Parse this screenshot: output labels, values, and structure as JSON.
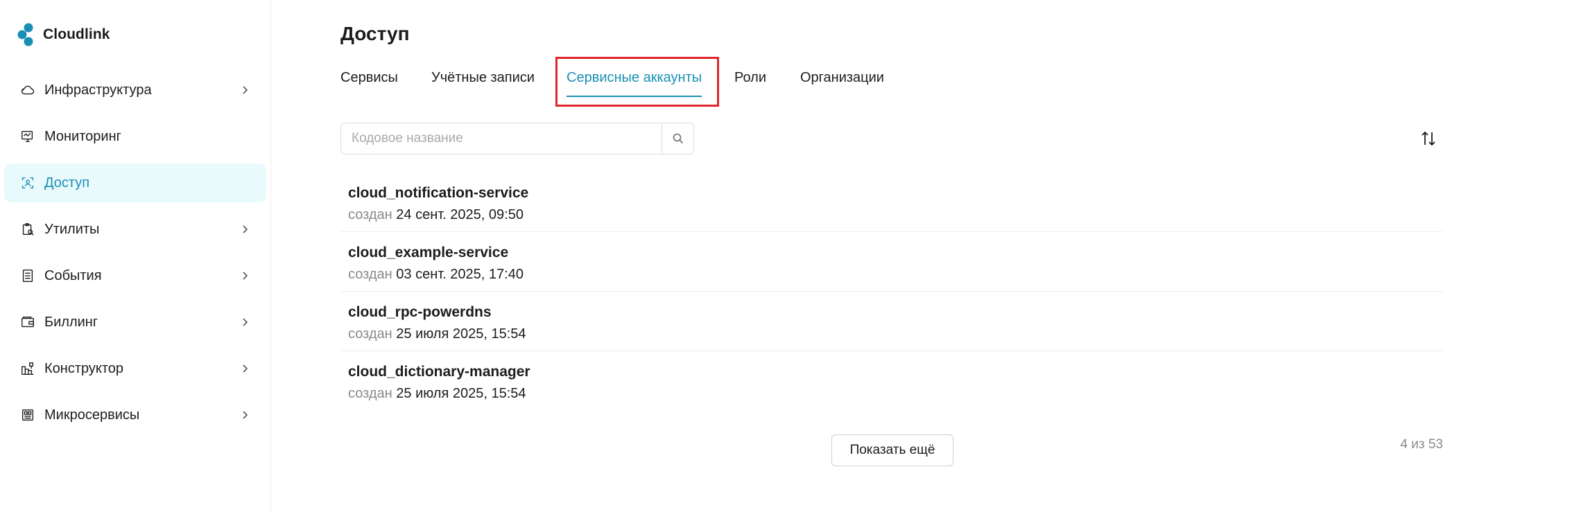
{
  "brand": {
    "name": "Cloudlink",
    "color": "#1a8fb5"
  },
  "sidebar": {
    "items": [
      {
        "label": "Инфраструктура",
        "icon": "cloud-icon",
        "has_chevron": true,
        "active": false
      },
      {
        "label": "Мониторинг",
        "icon": "monitor-icon",
        "has_chevron": false,
        "active": false
      },
      {
        "label": "Доступ",
        "icon": "access-icon",
        "has_chevron": false,
        "active": true
      },
      {
        "label": "Утилиты",
        "icon": "utilities-icon",
        "has_chevron": true,
        "active": false
      },
      {
        "label": "События",
        "icon": "events-icon",
        "has_chevron": true,
        "active": false
      },
      {
        "label": "Биллинг",
        "icon": "wallet-icon",
        "has_chevron": true,
        "active": false
      },
      {
        "label": "Конструктор",
        "icon": "constructor-icon",
        "has_chevron": true,
        "active": false
      },
      {
        "label": "Микросервисы",
        "icon": "microservices-icon",
        "has_chevron": true,
        "active": false
      }
    ]
  },
  "main": {
    "title": "Доступ",
    "tabs": [
      {
        "label": "Сервисы",
        "active": false
      },
      {
        "label": "Учётные записи",
        "active": false
      },
      {
        "label": "Сервисные аккаунты",
        "active": true
      },
      {
        "label": "Роли",
        "active": false
      },
      {
        "label": "Организации",
        "active": false
      }
    ],
    "search": {
      "placeholder": "Кодовое название",
      "value": ""
    },
    "list": [
      {
        "name": "cloud_notification-service",
        "created_label": "создан",
        "created_value": "24 сент. 2025, 09:50"
      },
      {
        "name": "cloud_example-service",
        "created_label": "создан",
        "created_value": "03 сент. 2025, 17:40"
      },
      {
        "name": "cloud_rpc-powerdns",
        "created_label": "создан",
        "created_value": "25 июля 2025, 15:54"
      },
      {
        "name": "cloud_dictionary-manager",
        "created_label": "создан",
        "created_value": "25 июля 2025, 15:54"
      }
    ],
    "show_more_label": "Показать ещё",
    "counter": "4 из 53"
  },
  "colors": {
    "accent": "#1a8fb5",
    "active_bg": "#e9fafd",
    "highlight": "#e0252b"
  }
}
